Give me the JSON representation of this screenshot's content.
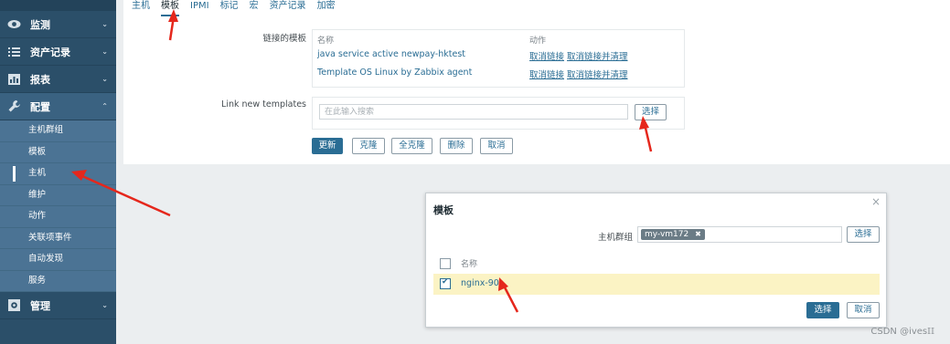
{
  "sidebar": {
    "items": [
      {
        "label": "监测",
        "icon": "eye-icon"
      },
      {
        "label": "资产记录",
        "icon": "list-icon"
      },
      {
        "label": "报表",
        "icon": "chart-icon"
      },
      {
        "label": "配置",
        "icon": "wrench-icon"
      },
      {
        "label": "管理",
        "icon": "gear-icon"
      }
    ],
    "config_sub": [
      "主机群组",
      "模板",
      "主机",
      "维护",
      "动作",
      "关联项事件",
      "自动发现",
      "服务"
    ]
  },
  "tabs": [
    "主机",
    "模板",
    "IPMI",
    "标记",
    "宏",
    "资产记录",
    "加密"
  ],
  "form": {
    "linked_label": "链接的模板",
    "col_name": "名称",
    "col_action": "动作",
    "templates": [
      "java service active newpay-hktest",
      "Template OS Linux by Zabbix agent"
    ],
    "unlink": "取消链接",
    "unlink_clear": "取消链接并清理",
    "link_new_label": "Link new templates",
    "search_placeholder": "在此输入搜索",
    "select": "选择",
    "buttons": {
      "update": "更新",
      "clone": "克隆",
      "full_clone": "全克隆",
      "delete": "删除",
      "cancel": "取消"
    }
  },
  "modal": {
    "title": "模板",
    "close": "×",
    "group_label": "主机群组",
    "group_chip": "my-vm172",
    "chip_remove": "✖",
    "select": "选择",
    "col_name": "名称",
    "row_name": "nginx-90",
    "ok": "选择",
    "cancel": "取消"
  },
  "watermark": "CSDN @ives𝕀𝕀",
  "colors": {
    "sidebar": "#2b4f69",
    "accent": "#2a6d94",
    "highlight": "#fbf3c4",
    "arrow": "#e5271c"
  }
}
